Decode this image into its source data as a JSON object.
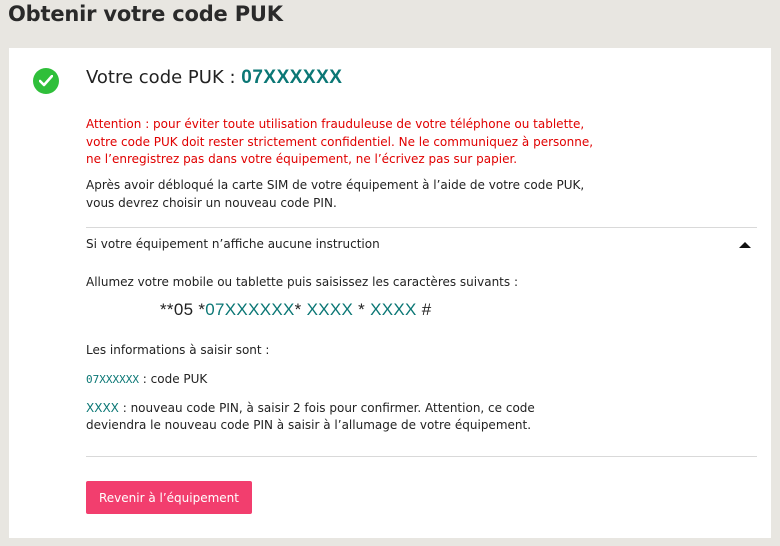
{
  "page": {
    "title": "Obtenir votre code PUK"
  },
  "result": {
    "label": "Votre code PUK : ",
    "puk_code": "07XXXXXX"
  },
  "warning": {
    "lines": [
      "Attention : pour éviter toute utilisation frauduleuse de votre téléphone ou tablette,",
      "votre code PUK doit rester strictement confidentiel. Ne le communiquez à personne,",
      "ne l’enregistrez pas dans votre équipement, ne l’écrivez pas sur papier."
    ]
  },
  "info": {
    "lines": [
      "Après avoir débloqué la carte SIM de votre équipement à l’aide de votre code PUK,",
      "vous devrez choisir un nouveau code PIN."
    ]
  },
  "accordion": {
    "title": "Si votre équipement n’affiche aucune instruction",
    "expanded": true,
    "instruction": "Allumez votre mobile ou tablette puis saisissez les caractères suivants :",
    "code": {
      "prefix": "**05 *",
      "puk": "07XXXXXX",
      "sep1": "* ",
      "pin1": "XXXX",
      "sep2": " * ",
      "pin2": "XXXX",
      "suffix": " #"
    },
    "fields_label": "Les informations à saisir sont :",
    "puk_field": {
      "code": "07XXXXXX",
      "desc": " : code PUK"
    },
    "pin_field": {
      "code": "XXXX",
      "desc_line1": " : nouveau code PIN, à saisir 2 fois pour confirmer. Attention, ce code",
      "desc_line2": "deviendra le nouveau code PIN à saisir à l’allumage de votre équipement."
    }
  },
  "actions": {
    "back_label": "Revenir à l’équipement"
  },
  "colors": {
    "accent_teal": "#0b7775",
    "warning_red": "#e00000",
    "success_green": "#2fbf3a",
    "button_pink": "#f23e6e"
  }
}
